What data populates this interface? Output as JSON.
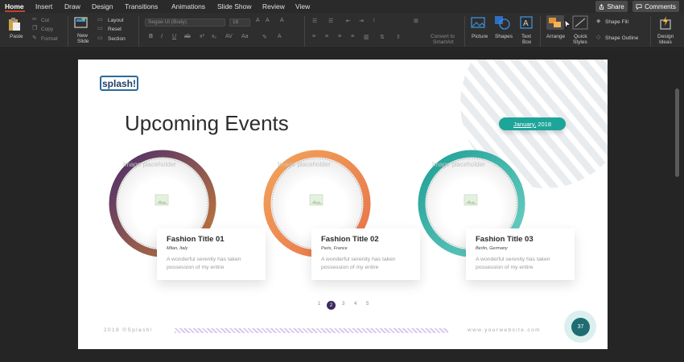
{
  "menu": {
    "tabs": [
      "Home",
      "Insert",
      "Draw",
      "Design",
      "Transitions",
      "Animations",
      "Slide Show",
      "Review",
      "View"
    ],
    "share_label": "Share",
    "comments_label": "Comments"
  },
  "ribbon": {
    "paste_label": "Paste",
    "cut_label": "Cut",
    "copy_label": "Copy",
    "format_label": "Format",
    "new_slide_label_1": "New",
    "new_slide_label_2": "Slide",
    "layout_label": "Layout",
    "reset_label": "Reset",
    "section_label": "Section",
    "font_name": "Segoe UI (Body)",
    "font_size": "18",
    "convert_label_1": "Convert to",
    "convert_label_2": "SmartArt",
    "picture_label": "Picture",
    "shapes_label": "Shapes",
    "textbox_label_1": "Text",
    "textbox_label_2": "Box",
    "arrange_label": "Arrange",
    "quick_styles_label_1": "Quick",
    "quick_styles_label_2": "Styles",
    "shape_fill_label": "Shape Fill",
    "shape_outline_label": "Shape Outline",
    "design_ideas_label_1": "Design",
    "design_ideas_label_2": "Ideas"
  },
  "slide": {
    "logo_text": "splash!",
    "title": "Upcoming Events",
    "date_month": "January,",
    "date_year": " 2018",
    "placeholder_label": "Image placeholder",
    "events": [
      {
        "title": "Fashion Title 01",
        "location": "Milan, Italy",
        "description": "A wonderful serenity has taken possession of my entire"
      },
      {
        "title": "Fashion Title 02",
        "location": "Paris, France",
        "description": "A wonderful serenity has taken possession of my entire"
      },
      {
        "title": "Fashion Title 03",
        "location": "Berlin, Germany",
        "description": "A wonderful serenity has taken possession of my entire"
      }
    ],
    "pager": [
      "1",
      "2",
      "3",
      "4",
      "5"
    ],
    "pager_active": "2",
    "footer_left": "2018 ©Splash!",
    "footer_right": "www.yourwebsite.com",
    "page_number": "37"
  },
  "colors": {
    "accent_tab": "#c0432b",
    "ring1_start": "#4a2d6b",
    "ring1_end": "#c77b3a",
    "ring2_start": "#f2a35a",
    "ring2_end": "#e8734a",
    "ring3_start": "#1e9f96",
    "ring3_end": "#6fd0c4",
    "teal_pill": "#1ea59a"
  }
}
